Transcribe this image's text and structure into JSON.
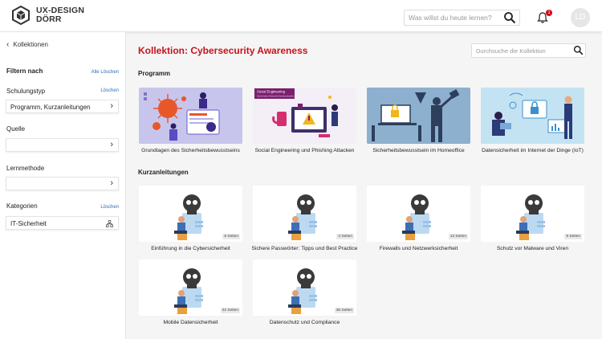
{
  "brand": {
    "line1": "UX-DESIGN",
    "line2": "DÖRR"
  },
  "header": {
    "search_placeholder": "Was willst du heute lernen?",
    "notification_count": "1",
    "avatar_initials": "LD"
  },
  "sidebar": {
    "back_label": "Kollektionen",
    "filter_title": "Filtern nach",
    "reset_all": "Alle Löschen",
    "filters": [
      {
        "label": "Schulungstyp",
        "clear": "Löschen",
        "value": "Programm, Kurzanleitungen"
      },
      {
        "label": "Quelle",
        "value": ""
      },
      {
        "label": "Lernmethode",
        "value": ""
      },
      {
        "label": "Kategorien",
        "clear": "Löschen",
        "value": "IT-Sicherheit"
      }
    ]
  },
  "main": {
    "title": "Kollektion: Cybersecurity Awareness",
    "search_placeholder": "Durchsuche die Kollektion",
    "program_heading": "Programm",
    "programs": [
      {
        "label": "Grundlagen des Sicherheitsbewusstseins"
      },
      {
        "label": "Social Engineering und Phishing Attacken",
        "banner": "Social Engineering",
        "banner_sub": "Sicherheits Netzwerk Schwachstellen"
      },
      {
        "label": "Sicherheitsbewusstsein im Homeoffice"
      },
      {
        "label": "Datensicherheit im Internet der Dinge (IoT)"
      }
    ],
    "guides_heading": "Kurzanleitungen",
    "guides": [
      {
        "label": "Einführung in die Cybersicherheit",
        "pages": "8 Seiten"
      },
      {
        "label": "Sichere Passwörter: Tipps und Best Practice",
        "pages": "4 Seiten"
      },
      {
        "label": "Firewalls und Netzwerksicherheit",
        "pages": "13 Seiten"
      },
      {
        "label": "Schutz vor Malware und Viren",
        "pages": "9 Seiten"
      },
      {
        "label": "Mobile Datensicherheit",
        "pages": "22 Seiten"
      },
      {
        "label": "Datenschutz und Compliance",
        "pages": "36 Seiten"
      }
    ]
  },
  "colors": {
    "accent": "#c7131b",
    "link": "#2a6db5",
    "badge": "#d0021b"
  }
}
